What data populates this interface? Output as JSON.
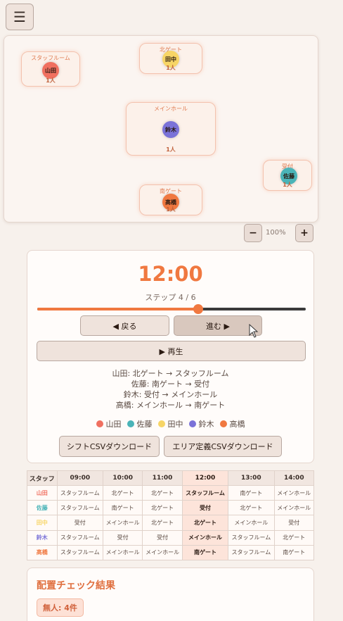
{
  "menu": {
    "icon": "hamburger-icon",
    "glyph": "☰"
  },
  "map": {
    "areas": [
      {
        "id": "staff",
        "name": "スタッフルーム",
        "count": "1人",
        "members": [
          {
            "name": "山田",
            "color": "#f07060"
          }
        ]
      },
      {
        "id": "north",
        "name": "北ゲート",
        "count": "1人",
        "members": [
          {
            "name": "田中",
            "color": "#f7d566"
          }
        ]
      },
      {
        "id": "main",
        "name": "メインホール",
        "count": "1人",
        "members": [
          {
            "name": "鈴木",
            "color": "#7a72d8"
          }
        ]
      },
      {
        "id": "reception",
        "name": "受付",
        "count": "1人",
        "members": [
          {
            "name": "佐藤",
            "color": "#4ab4b8"
          }
        ]
      },
      {
        "id": "south",
        "name": "南ゲート",
        "count": "1人",
        "members": [
          {
            "name": "高橋",
            "color": "#f07840"
          }
        ]
      }
    ]
  },
  "zoom": {
    "minus": "−",
    "plus": "+",
    "level": "100%"
  },
  "player": {
    "time": "12:00",
    "step_label": "ステップ 4 / 6",
    "progress": 0.6,
    "back_label": "◀ 戻る",
    "forward_label": "進む ▶",
    "play_label": "▶ 再生",
    "moves": [
      "山田: 北ゲート → スタッフルーム",
      "佐藤: 南ゲート → 受付",
      "鈴木: 受付 → メインホール",
      "高橋: メインホール → 南ゲート"
    ],
    "legend": [
      {
        "name": "山田",
        "color": "#f07060"
      },
      {
        "name": "佐藤",
        "color": "#4ab4b8"
      },
      {
        "name": "田中",
        "color": "#f7d566"
      },
      {
        "name": "鈴木",
        "color": "#7a72d8"
      },
      {
        "name": "高橋",
        "color": "#f07840"
      }
    ],
    "csv_shift_label": "シフトCSVダウンロード",
    "csv_area_label": "エリア定義CSVダウンロード"
  },
  "table": {
    "corner": "スタッフ",
    "times": [
      "09:00",
      "10:00",
      "11:00",
      "12:00",
      "13:00",
      "14:00"
    ],
    "current_index": 3,
    "rows": [
      {
        "staff": "山田",
        "color": "#f07060",
        "cells": [
          "スタッフルーム",
          "北ゲート",
          "北ゲート",
          "スタッフルーム",
          "南ゲート",
          "メインホール"
        ]
      },
      {
        "staff": "佐藤",
        "color": "#4ab4b8",
        "cells": [
          "スタッフルーム",
          "南ゲート",
          "北ゲート",
          "受付",
          "北ゲート",
          "メインホール"
        ]
      },
      {
        "staff": "田中",
        "color": "#f7d566",
        "cells": [
          "受付",
          "メインホール",
          "北ゲート",
          "北ゲート",
          "メインホール",
          "受付"
        ]
      },
      {
        "staff": "鈴木",
        "color": "#7a72d8",
        "cells": [
          "スタッフルーム",
          "受付",
          "受付",
          "メインホール",
          "スタッフルーム",
          "北ゲート"
        ]
      },
      {
        "staff": "高橋",
        "color": "#f07840",
        "cells": [
          "スタッフルーム",
          "メインホール",
          "メインホール",
          "南ゲート",
          "スタッフルーム",
          "南ゲート"
        ]
      }
    ]
  },
  "result": {
    "title": "配置チェック結果",
    "badge": "無人: 4件"
  }
}
